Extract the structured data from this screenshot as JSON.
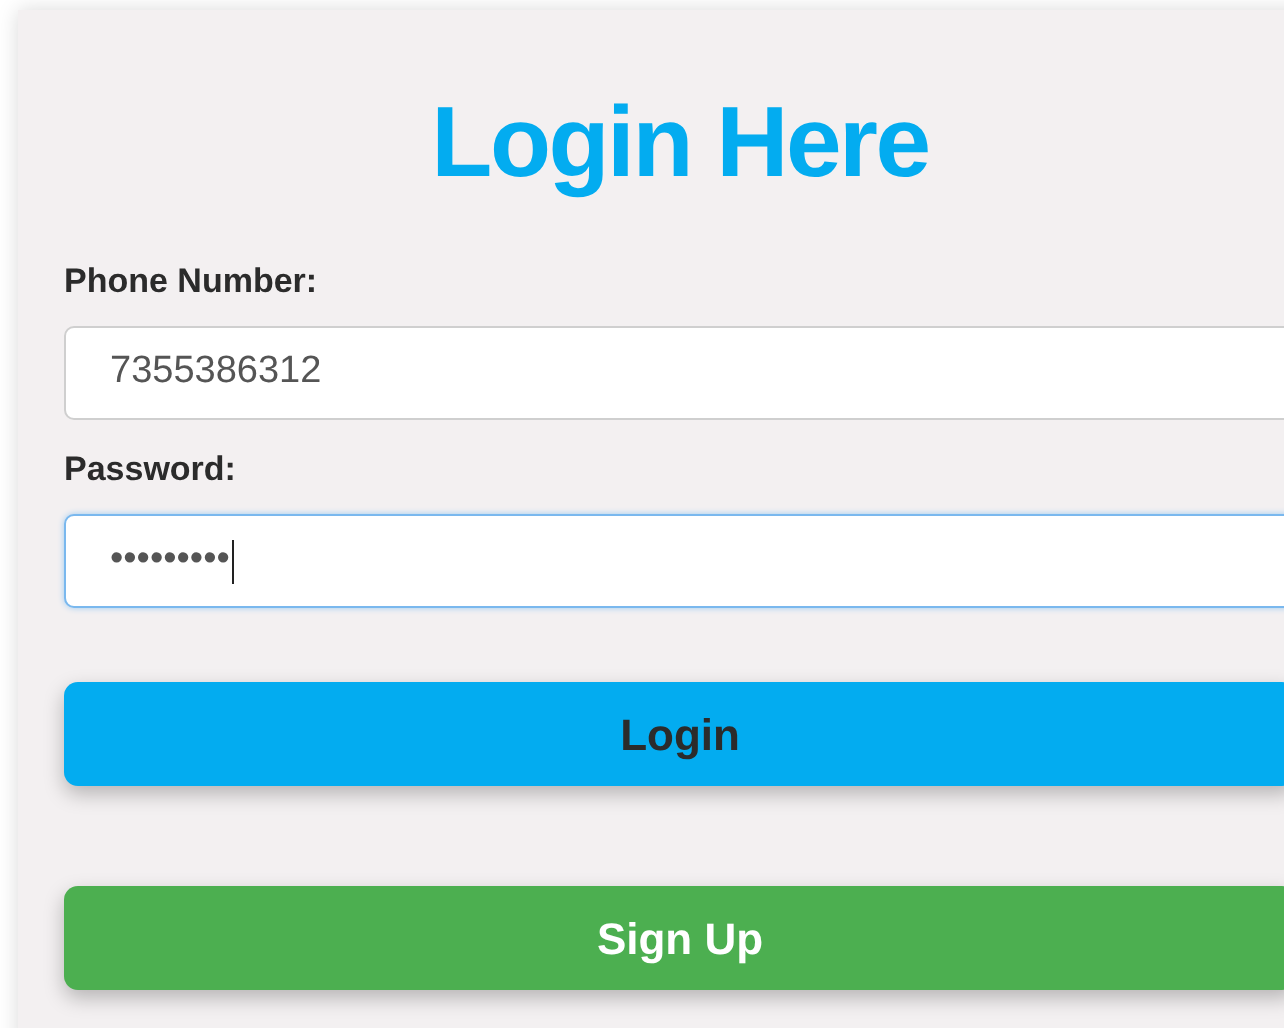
{
  "title": "Login Here",
  "fields": [
    {
      "label": "Phone Number:",
      "value": "7355386312",
      "focused": false
    },
    {
      "label": "Password:",
      "value": "•••••••••",
      "focused": true
    }
  ],
  "buttons": [
    {
      "label": "Login",
      "kind": "primary"
    },
    {
      "label": "Sign Up",
      "kind": "secondary"
    }
  ]
}
